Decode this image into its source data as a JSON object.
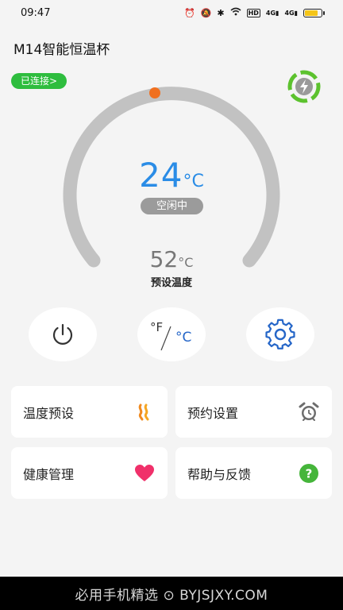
{
  "status_bar": {
    "time": "09:47",
    "network_label": "HD",
    "signal_labels": [
      "4G",
      "4G"
    ]
  },
  "app": {
    "title": "M14智能恒温杯",
    "connection_badge": "已连接>"
  },
  "dial": {
    "current_temp": "24",
    "current_unit": "°C",
    "state": "空闲中",
    "preset_temp": "52",
    "preset_unit": "°C",
    "preset_label": "预设温度",
    "arc_color": "#c2c2c2",
    "indicator_color": "#f07020",
    "temp_color": "#2a8ce6"
  },
  "controls": {
    "unit_f": "°F",
    "unit_c": "°C"
  },
  "cards": [
    {
      "label": "温度预设",
      "icon": "heat-waves-icon"
    },
    {
      "label": "预约设置",
      "icon": "alarm-clock-icon"
    },
    {
      "label": "健康管理",
      "icon": "heart-icon"
    },
    {
      "label": "帮助与反馈",
      "icon": "help-icon"
    }
  ],
  "colors": {
    "connected": "#2ebd3e",
    "accent_blue": "#2566c8",
    "heart": "#f0306a",
    "help": "#45b53a",
    "heat": "#f08a20"
  },
  "footer": {
    "watermark": "必用手机精选 ⊙ BYJSJXY.COM"
  }
}
